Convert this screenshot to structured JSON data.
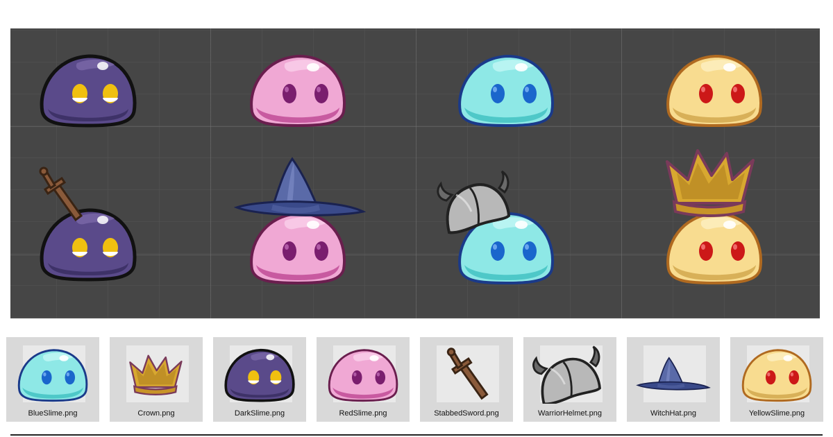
{
  "scene": {
    "background": "#464646",
    "sprites": [
      {
        "name": "dark-slime-sprite",
        "kind": "DarkSlime"
      },
      {
        "name": "red-slime-sprite",
        "kind": "RedSlime"
      },
      {
        "name": "blue-slime-sprite",
        "kind": "BlueSlime"
      },
      {
        "name": "yellow-slime-sprite",
        "kind": "YellowSlime"
      },
      {
        "name": "dark-slime-with-sword-sprite",
        "kind": "DarkSlime",
        "accessory": "StabbedSword"
      },
      {
        "name": "red-slime-with-witch-hat-sprite",
        "kind": "RedSlime",
        "accessory": "WitchHat"
      },
      {
        "name": "blue-slime-with-helmet-sprite",
        "kind": "BlueSlime",
        "accessory": "WarriorHelmet"
      },
      {
        "name": "yellow-slime-with-crown-sprite",
        "kind": "YellowSlime",
        "accessory": "Crown"
      }
    ]
  },
  "assets": [
    {
      "label": "BlueSlime.png",
      "icon": "blue-slime-icon"
    },
    {
      "label": "Crown.png",
      "icon": "crown-icon"
    },
    {
      "label": "DarkSlime.png",
      "icon": "dark-slime-icon"
    },
    {
      "label": "RedSlime.png",
      "icon": "red-slime-icon"
    },
    {
      "label": "StabbedSword.png",
      "icon": "sword-icon"
    },
    {
      "label": "WarriorHelmet.png",
      "icon": "warrior-helmet-icon"
    },
    {
      "label": "WitchHat.png",
      "icon": "witch-hat-icon"
    },
    {
      "label": "YellowSlime.png",
      "icon": "yellow-slime-icon"
    }
  ],
  "colors": {
    "dark": {
      "body": "#5a4a8a",
      "light": "#7a68a8",
      "dark": "#3e3268",
      "eye": "#f0c010",
      "outline": "#111111"
    },
    "red": {
      "body": "#f0a8d4",
      "light": "#f8c8e6",
      "dark": "#c85aa0",
      "eye": "#7a1e6e",
      "outline": "#6a1e4e"
    },
    "blue": {
      "body": "#8ee8e6",
      "light": "#b8f4f2",
      "dark": "#4ec8c8",
      "eye": "#1a66cc",
      "outline": "#1a3a8a"
    },
    "yellow": {
      "body": "#f8dc90",
      "light": "#fcecb8",
      "dark": "#d8b058",
      "eye": "#cc1818",
      "outline": "#b06a20"
    }
  }
}
